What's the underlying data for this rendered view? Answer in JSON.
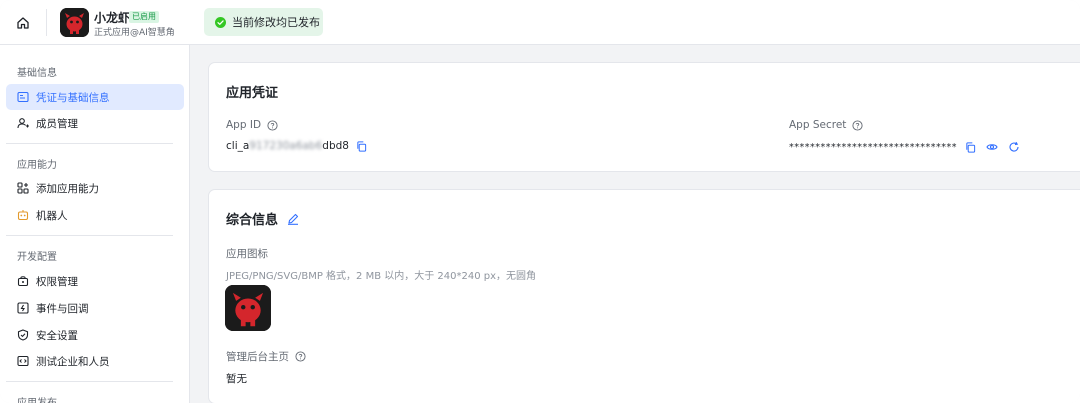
{
  "topbar": {
    "app_name": "小龙虾",
    "badge": "已启用",
    "app_subtitle": "正式应用@AI智慧角",
    "toast_text": "当前修改均已发布"
  },
  "sidebar": {
    "groups": [
      {
        "title": "基础信息",
        "items": [
          {
            "label": "凭证与基础信息",
            "icon": "credential-icon",
            "active": true
          },
          {
            "label": "成员管理",
            "icon": "member-icon",
            "active": false
          }
        ]
      },
      {
        "title": "应用能力",
        "items": [
          {
            "label": "添加应用能力",
            "icon": "add-capability-icon",
            "active": false
          },
          {
            "label": "机器人",
            "icon": "robot-icon",
            "active": false
          }
        ]
      },
      {
        "title": "开发配置",
        "items": [
          {
            "label": "权限管理",
            "icon": "permission-icon",
            "active": false
          },
          {
            "label": "事件与回调",
            "icon": "event-icon",
            "active": false
          },
          {
            "label": "安全设置",
            "icon": "shield-icon",
            "active": false
          },
          {
            "label": "测试企业和人员",
            "icon": "test-icon",
            "active": false
          }
        ]
      },
      {
        "title": "应用发布",
        "items": []
      }
    ]
  },
  "credentials": {
    "title": "应用凭证",
    "app_id_label": "App ID",
    "app_id_prefix": "cli_a",
    "app_id_masked": "917230a6ab6",
    "app_id_suffix": "dbd8",
    "app_secret_label": "App Secret",
    "app_secret_value": "********************************"
  },
  "general": {
    "title": "综合信息",
    "icon_label": "应用图标",
    "icon_hint": "JPEG/PNG/SVG/BMP 格式，2 MB 以内，大于 240*240 px，无圆角",
    "homepage_label": "管理后台主页",
    "homepage_value": "暂无"
  },
  "colors": {
    "accent": "#3370ff",
    "success": "#1c9b4b",
    "toast_bg": "#e4f5e9",
    "active_bg": "#e1eaff"
  }
}
